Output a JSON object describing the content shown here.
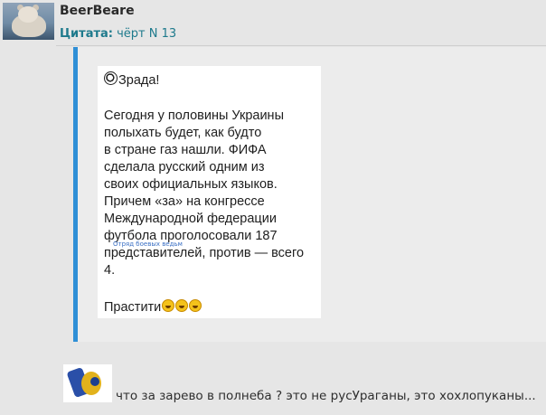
{
  "post": {
    "author": "BeerBeare",
    "quote_label": "Цитата:",
    "quote_source": "чёрт N 13"
  },
  "quoted_image": {
    "title": "Зрада!",
    "body_lines": [
      "Сегодня у половины Украины",
      "полыхать будет, как будто",
      "в стране газ нашли. ФИФА",
      "сделала русский одним из",
      "своих официальных языков.",
      "Причем «за» на конгрессе",
      "Международной федерации",
      "футбола проголосовали 187",
      "представителей, против — всего",
      "4."
    ],
    "signoff": "Прастити",
    "watermark": "Отряд боевых ведьм"
  },
  "reply": {
    "text": "что за зарево в полнеба ? это не русУраганы, это хохлопуканы..."
  }
}
